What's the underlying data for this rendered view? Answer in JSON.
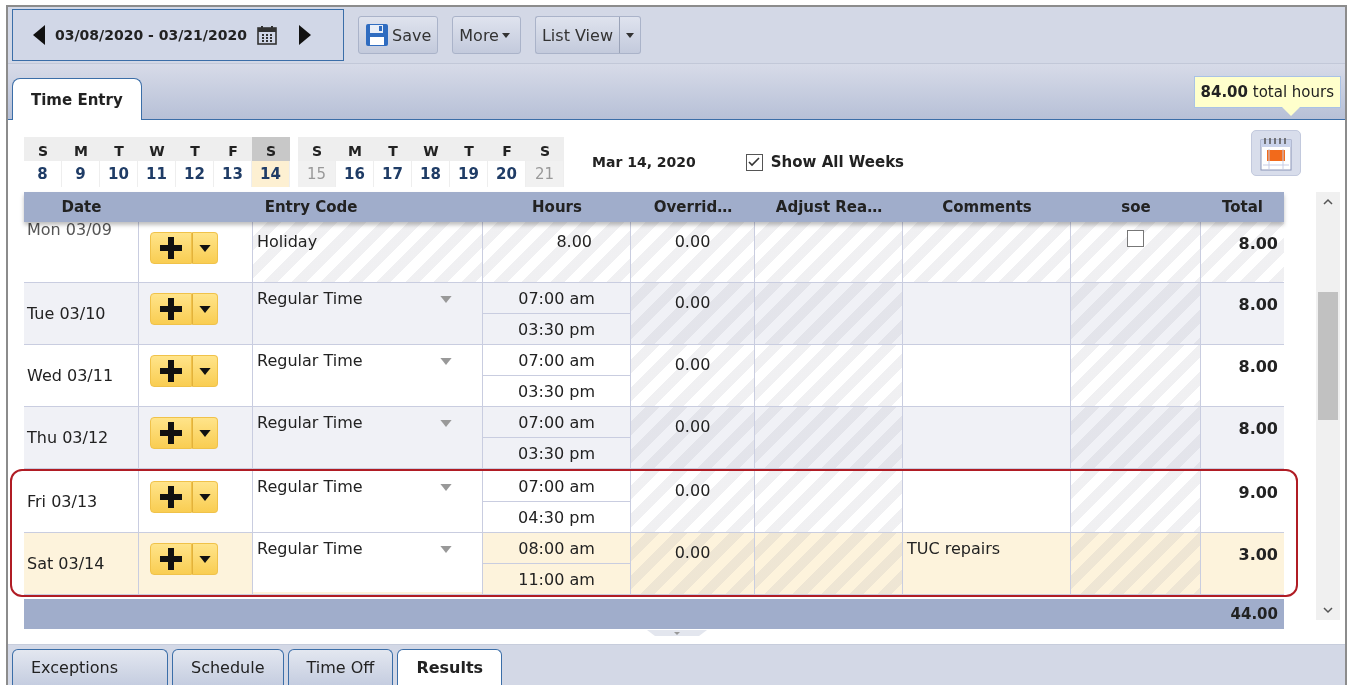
{
  "toolbar": {
    "date_range": "03/08/2020 - 03/21/2020",
    "buttons": [
      {
        "kind": "save",
        "label": "Save"
      },
      {
        "kind": "menu",
        "label": "More"
      },
      {
        "kind": "split",
        "label": "List View"
      }
    ]
  },
  "tabs": [
    {
      "label": "Time Entry",
      "selected": true
    }
  ],
  "total_hours": {
    "value": "84.00",
    "label": "total hours"
  },
  "calendar": {
    "weeks": [
      {
        "days": [
          {
            "letter": "S",
            "number": "8",
            "selected": false,
            "muted": false
          },
          {
            "letter": "M",
            "number": "9",
            "selected": false,
            "muted": false
          },
          {
            "letter": "T",
            "number": "10",
            "selected": false,
            "muted": false
          },
          {
            "letter": "W",
            "number": "11",
            "selected": false,
            "muted": false
          },
          {
            "letter": "T",
            "number": "12",
            "selected": false,
            "muted": false
          },
          {
            "letter": "F",
            "number": "13",
            "selected": false,
            "muted": false
          },
          {
            "letter": "S",
            "number": "14",
            "selected": true,
            "muted": false
          }
        ]
      },
      {
        "days": [
          {
            "letter": "S",
            "number": "15",
            "selected": false,
            "muted": true
          },
          {
            "letter": "M",
            "number": "16",
            "selected": false,
            "muted": false
          },
          {
            "letter": "T",
            "number": "17",
            "selected": false,
            "muted": false
          },
          {
            "letter": "W",
            "number": "18",
            "selected": false,
            "muted": false
          },
          {
            "letter": "T",
            "number": "19",
            "selected": false,
            "muted": false
          },
          {
            "letter": "F",
            "number": "20",
            "selected": false,
            "muted": false
          },
          {
            "letter": "S",
            "number": "21",
            "selected": false,
            "muted": true
          }
        ]
      }
    ],
    "current_date": "Mar 14, 2020",
    "show_all_weeks": {
      "label": "Show All Weeks",
      "checked": true
    }
  },
  "table": {
    "columns": [
      "Date",
      "Entry Code",
      "Hours",
      "Overrid…",
      "Adjust Rea…",
      "Comments",
      "soe",
      "Total"
    ],
    "rows": [
      {
        "date": "Mon 03/09",
        "kind": "hours",
        "entry_code": "Holiday",
        "hours": "8.00",
        "override": "0.00",
        "soe_checked": false,
        "total": "8.00",
        "selected": false,
        "outlined": false
      },
      {
        "date": "Tue 03/10",
        "kind": "range",
        "entry_code": "Regular Time",
        "start": "07:00 am",
        "end": "03:30 pm",
        "override": "0.00",
        "total": "8.00",
        "selected": false,
        "outlined": false
      },
      {
        "date": "Wed 03/11",
        "kind": "range",
        "entry_code": "Regular Time",
        "start": "07:00 am",
        "end": "03:30 pm",
        "override": "0.00",
        "total": "8.00",
        "selected": false,
        "outlined": false
      },
      {
        "date": "Thu 03/12",
        "kind": "range",
        "entry_code": "Regular Time",
        "start": "07:00 am",
        "end": "03:30 pm",
        "override": "0.00",
        "total": "8.00",
        "selected": false,
        "outlined": false
      },
      {
        "date": "Fri 03/13",
        "kind": "range",
        "entry_code": "Regular Time",
        "start": "07:00 am",
        "end": "04:30 pm",
        "override": "0.00",
        "total": "9.00",
        "selected": false,
        "outlined": true
      },
      {
        "date": "Sat 03/14",
        "kind": "range",
        "entry_code": "Regular Time",
        "start": "08:00 am",
        "end": "11:00 am",
        "override": "0.00",
        "comments": "TUC repairs",
        "total": "3.00",
        "selected": true,
        "outlined": true
      }
    ],
    "footer_total": "44.00"
  },
  "bottom_tabs": [
    {
      "label": "Exceptions",
      "selected": false
    },
    {
      "label": "Schedule",
      "selected": false
    },
    {
      "label": "Time Off",
      "selected": false
    },
    {
      "label": "Results",
      "selected": true
    }
  ]
}
